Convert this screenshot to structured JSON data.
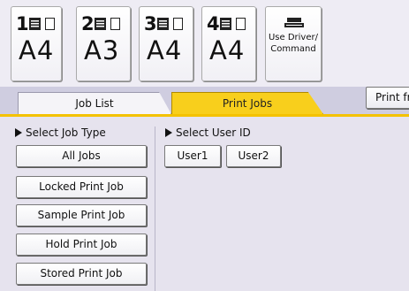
{
  "trays": [
    {
      "number": "1",
      "size": "A4"
    },
    {
      "number": "2",
      "size": "A3"
    },
    {
      "number": "3",
      "size": "A4"
    },
    {
      "number": "4",
      "size": "A4"
    }
  ],
  "driver_button": {
    "line1": "Use Driver/",
    "line2": "Command"
  },
  "tabs": {
    "job_list": "Job List",
    "print_jobs": "Print Jobs"
  },
  "print_from_button": "Print fr",
  "select_job_type": {
    "label": "Select Job Type",
    "buttons": [
      "All Jobs",
      "Locked Print Job",
      "Sample Print Job",
      "Hold Print Job",
      "Stored Print Job"
    ]
  },
  "select_user_id": {
    "label": "Select User ID",
    "buttons": [
      "User1",
      "User2"
    ]
  },
  "colors": {
    "active_tab": "#f8cf1c",
    "accent_line": "#f4c200",
    "background": "#e6e3ee"
  }
}
